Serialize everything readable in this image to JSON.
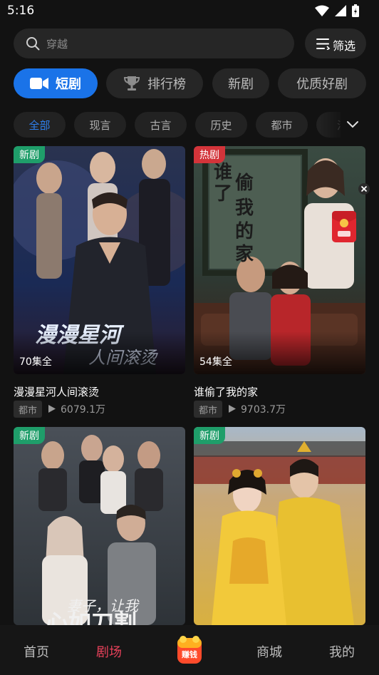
{
  "status_bar": {
    "time": "5:16",
    "icons": [
      "wifi-icon",
      "signal-icon",
      "battery-icon"
    ]
  },
  "search": {
    "placeholder": "穿越",
    "icon": "search-icon"
  },
  "filter_button": {
    "label": "筛选",
    "icon": "filter-list-icon"
  },
  "category_tabs": [
    {
      "label": "短剧",
      "icon": "video-camera-icon",
      "active": true
    },
    {
      "label": "排行榜",
      "icon": "trophy-icon",
      "active": false
    },
    {
      "label": "新剧",
      "active": false
    },
    {
      "label": "优质好剧",
      "active": false
    }
  ],
  "genre_chips": [
    {
      "label": "全部",
      "active": true
    },
    {
      "label": "现言",
      "active": false
    },
    {
      "label": "古言",
      "active": false
    },
    {
      "label": "历史",
      "active": false
    },
    {
      "label": "都市",
      "active": false
    },
    {
      "label": "活",
      "active": false
    }
  ],
  "cards": [
    {
      "badge": "新剧",
      "badge_type": "new",
      "episodes": "70集全",
      "title": "漫漫星河人间滚烫",
      "genre": "都市",
      "plays": "6079.1万",
      "poster_text": "漫漫星河 人间滚烫"
    },
    {
      "badge": "热剧",
      "badge_type": "hot",
      "episodes": "54集全",
      "title": "谁偷了我的家",
      "genre": "都市",
      "plays": "9703.7万",
      "poster_text": "谁偷了我的家"
    },
    {
      "badge": "新剧",
      "badge_type": "new",
      "poster_text": "妻子，让我 心如刀割"
    },
    {
      "badge": "新剧",
      "badge_type": "new"
    }
  ],
  "red_packet": {
    "icon": "red-envelope-icon",
    "close_icon": "close-icon"
  },
  "bottom_nav": {
    "items": [
      {
        "label": "首页",
        "active": false
      },
      {
        "label": "剧场",
        "active": true
      },
      {
        "label": "赚钱",
        "icon": "coin-bag-icon",
        "active": false
      },
      {
        "label": "商城",
        "active": false
      },
      {
        "label": "我的",
        "active": false
      }
    ]
  },
  "colors": {
    "background": "#121212",
    "accent_blue": "#1a73e8",
    "nav_active": "#e8415a",
    "badge_new": "#1f9e6a",
    "badge_hot": "#d3343a"
  }
}
